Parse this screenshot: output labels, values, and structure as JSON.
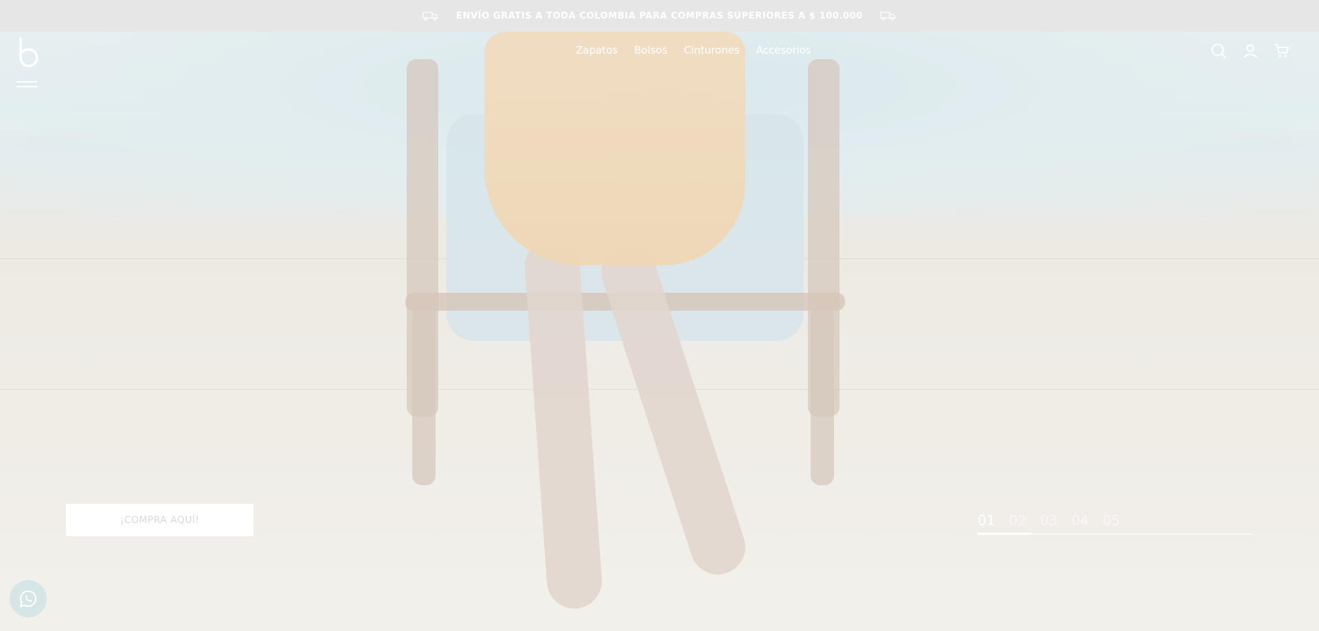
{
  "announcement": {
    "text": "ENVÍO GRATIS A TODA COLOMBIA PARA COMPRAS SUPERIORES A $ 100.000",
    "icon": "truck-icon"
  },
  "header": {
    "logo_icon": "b-logo-icon",
    "menu_icon": "hamburger-menu-icon",
    "nav": [
      {
        "label": "Zapatos"
      },
      {
        "label": "Bolsos"
      },
      {
        "label": "Cinturones"
      },
      {
        "label": "Accesorios"
      }
    ],
    "icons": [
      "search-icon",
      "user-icon",
      "cart-icon"
    ]
  },
  "hero": {
    "cta_label": "¡COMPRA AQUÍ!",
    "slides": [
      "01",
      "02",
      "03",
      "04",
      "05"
    ],
    "active_slide": 0,
    "progress_fraction": 0.2
  },
  "whatsapp": {
    "icon": "whatsapp-icon"
  },
  "colors": {
    "bar_bg": "#e6e6e6",
    "text_on_image": "#ffffff",
    "cta_text": "#d9d9d9"
  }
}
